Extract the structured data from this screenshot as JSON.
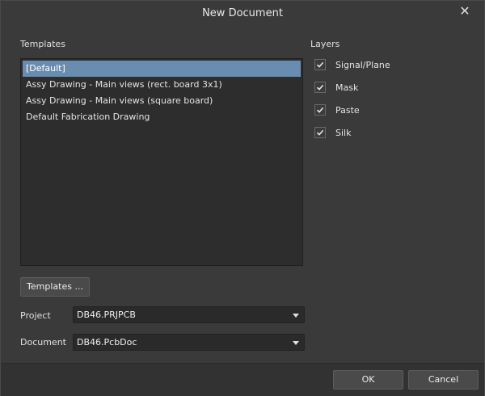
{
  "window": {
    "title": "New Document",
    "close_glyph": "✕"
  },
  "templates": {
    "label": "Templates",
    "items": [
      "[Default]",
      "Assy Drawing - Main views (rect. board 3x1)",
      "Assy Drawing - Main views (square board)",
      "Default Fabrication Drawing"
    ],
    "selected_index": 0,
    "button_label": "Templates ..."
  },
  "layers": {
    "label": "Layers",
    "items": [
      {
        "label": "Signal/Plane",
        "checked": true
      },
      {
        "label": "Mask",
        "checked": true
      },
      {
        "label": "Paste",
        "checked": true
      },
      {
        "label": "Silk",
        "checked": true
      }
    ]
  },
  "project": {
    "label": "Project",
    "value": "DB46.PRJPCB"
  },
  "document": {
    "label": "Document",
    "value": "DB46.PcbDoc"
  },
  "footer": {
    "ok_label": "OK",
    "cancel_label": "Cancel"
  },
  "colors": {
    "selection": "#6a8cb0",
    "background": "#3a3a3a"
  }
}
